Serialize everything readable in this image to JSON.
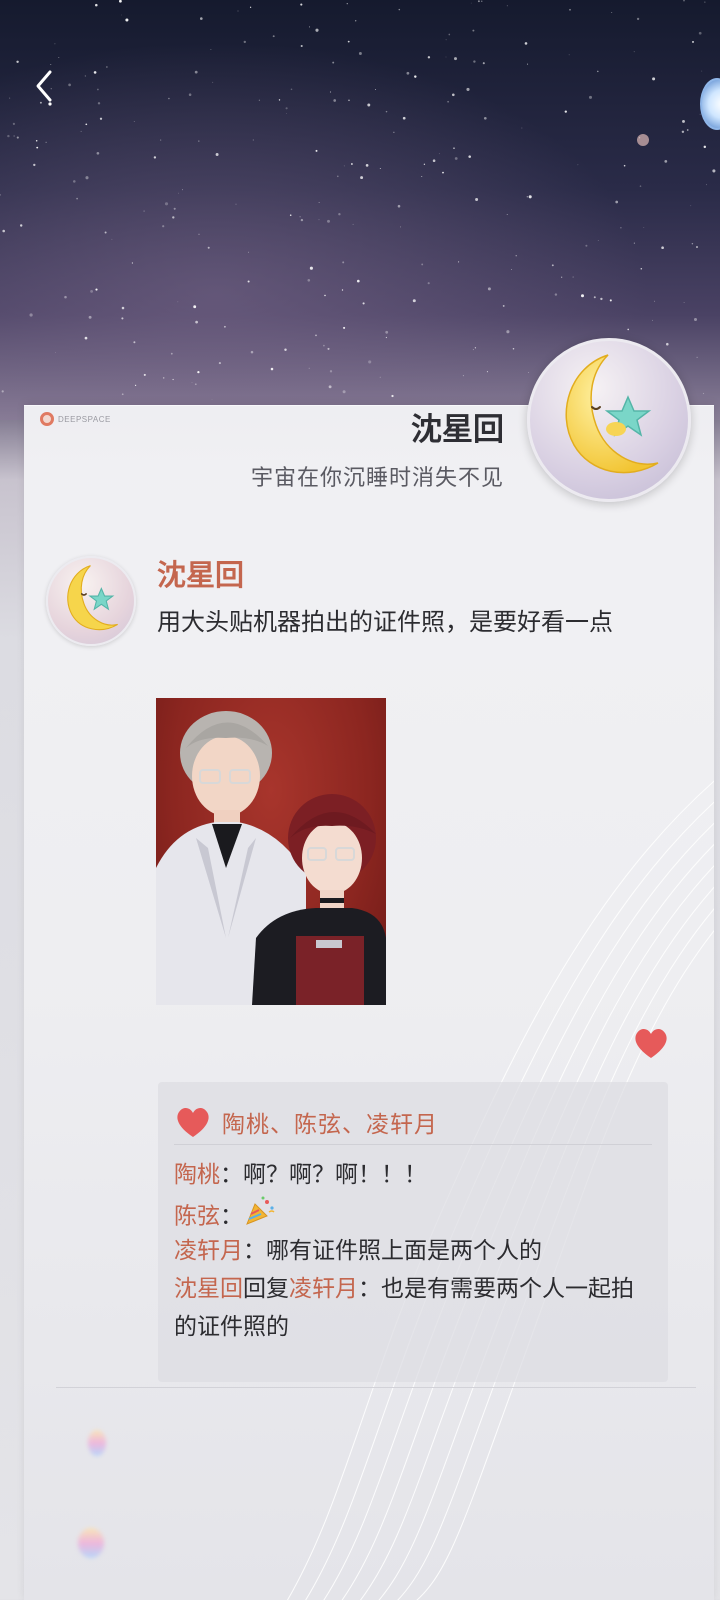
{
  "header": {
    "back_icon": "chevron-left-icon"
  },
  "brand": {
    "text": "DEEPSPACE"
  },
  "profile": {
    "name": "沈星回",
    "bio": "宇宙在你沉睡时消失不见",
    "avatar": "moon-star-plush-avatar"
  },
  "post": {
    "author": "沈星回",
    "text": "用大头贴机器拍出的证件照，是要好看一点",
    "photo": "couple-id-photo",
    "like_icon": "heart-icon"
  },
  "likes": {
    "icon": "heart-icon",
    "names": "陶桃、陈弦、凌轩月"
  },
  "comments": [
    {
      "name": "陶桃",
      "sep": "：",
      "text": "啊？啊？啊！！！"
    },
    {
      "name": "陈弦",
      "sep": "：",
      "text": "",
      "emoji": "party-popper-icon"
    },
    {
      "name": "凌轩月",
      "sep": "：",
      "text": "哪有证件照上面是两个人的"
    },
    {
      "name": "沈星回",
      "reply_word": "回复",
      "reply_to": "凌轩月",
      "sep": "：",
      "text": "也是有需要两个人一起拍的证件照的"
    }
  ],
  "colors": {
    "accent": "#c4664e",
    "like_heart": "#e65a5a",
    "text": "#2c2c30"
  }
}
